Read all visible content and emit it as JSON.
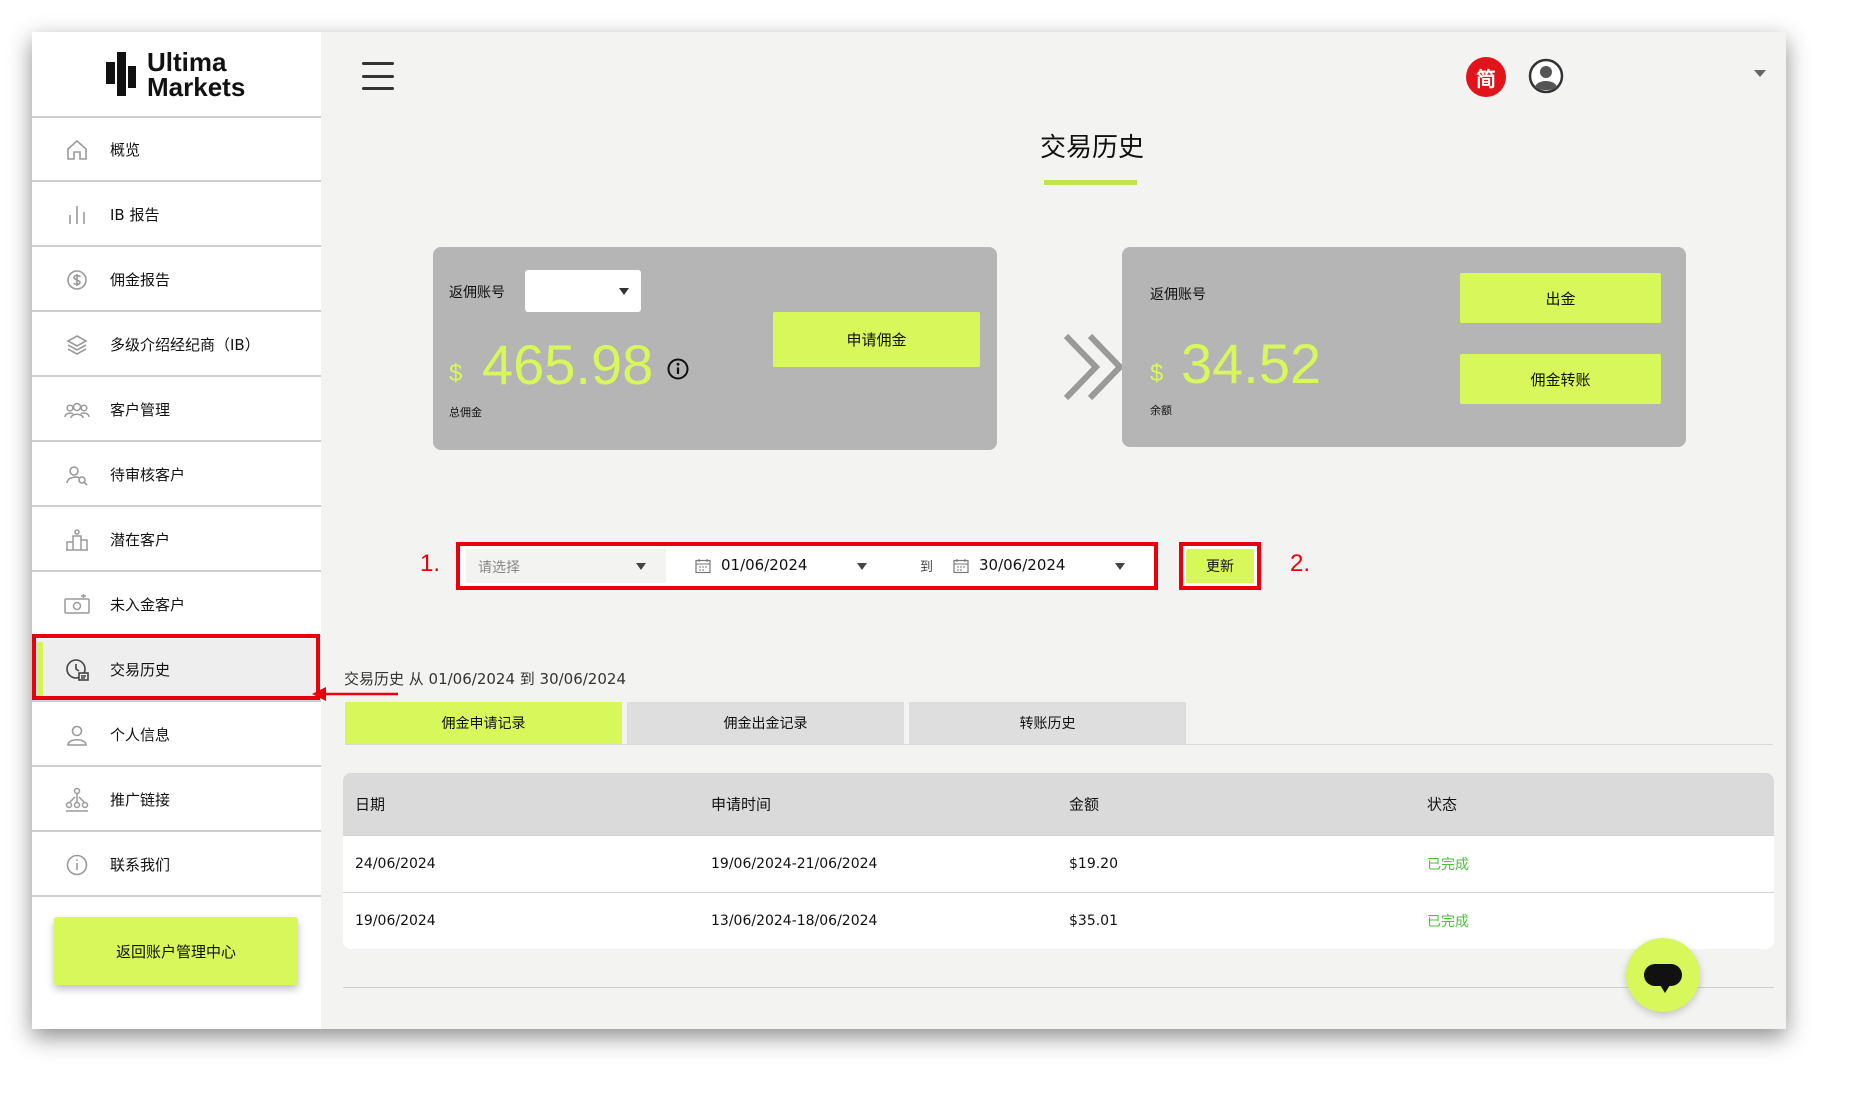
{
  "brand": {
    "line1": "Ultima",
    "line2": "Markets",
    "accent_color": "#d7f75b",
    "alert_color": "#e8000b"
  },
  "sidebar": {
    "items": [
      {
        "label": "概览",
        "icon": "home-icon"
      },
      {
        "label": "IB 报告",
        "icon": "bar-chart-icon"
      },
      {
        "label": "佣金报告",
        "icon": "dollar-coin-icon"
      },
      {
        "label": "多级介绍经纪商（IB）",
        "icon": "layers-icon"
      },
      {
        "label": "客户管理",
        "icon": "group-icon"
      },
      {
        "label": "待审核客户",
        "icon": "user-search-icon"
      },
      {
        "label": "潜在客户",
        "icon": "podium-icon"
      },
      {
        "label": "未入金客户",
        "icon": "money-icon"
      },
      {
        "label": "交易历史",
        "icon": "history-icon",
        "active": true
      },
      {
        "label": "个人信息",
        "icon": "user-icon"
      },
      {
        "label": "推广链接",
        "icon": "network-icon"
      },
      {
        "label": "联系我们",
        "icon": "info-icon"
      }
    ],
    "back_button": "返回账户管理中心"
  },
  "header": {
    "language_badge": "简"
  },
  "page": {
    "title": "交易历史"
  },
  "card_left": {
    "account_label": "返佣账号",
    "currency": "$",
    "amount": "465.98",
    "amount_caption": "总佣金",
    "apply_button": "申请佣金"
  },
  "card_right": {
    "account_label": "返佣账号",
    "currency": "$",
    "amount": "34.52",
    "amount_caption": "余额",
    "withdraw_button": "出金",
    "transfer_button": "佣金转账"
  },
  "filter": {
    "step1": "1.",
    "step2": "2.",
    "select_placeholder": "请选择",
    "date_from": "01/06/2024",
    "to_label": "到",
    "date_to": "30/06/2024",
    "update_button": "更新"
  },
  "history": {
    "caption": "交易历史 从 01/06/2024 到 30/06/2024",
    "tabs": [
      "佣金申请记录",
      "佣金出金记录",
      "转账历史"
    ],
    "columns": [
      "日期",
      "申请时间",
      "金额",
      "状态"
    ],
    "rows": [
      {
        "date": "24/06/2024",
        "period": "19/06/2024-21/06/2024",
        "amount": "$19.20",
        "status": "已完成"
      },
      {
        "date": "19/06/2024",
        "period": "13/06/2024-18/06/2024",
        "amount": "$35.01",
        "status": "已完成"
      }
    ]
  }
}
